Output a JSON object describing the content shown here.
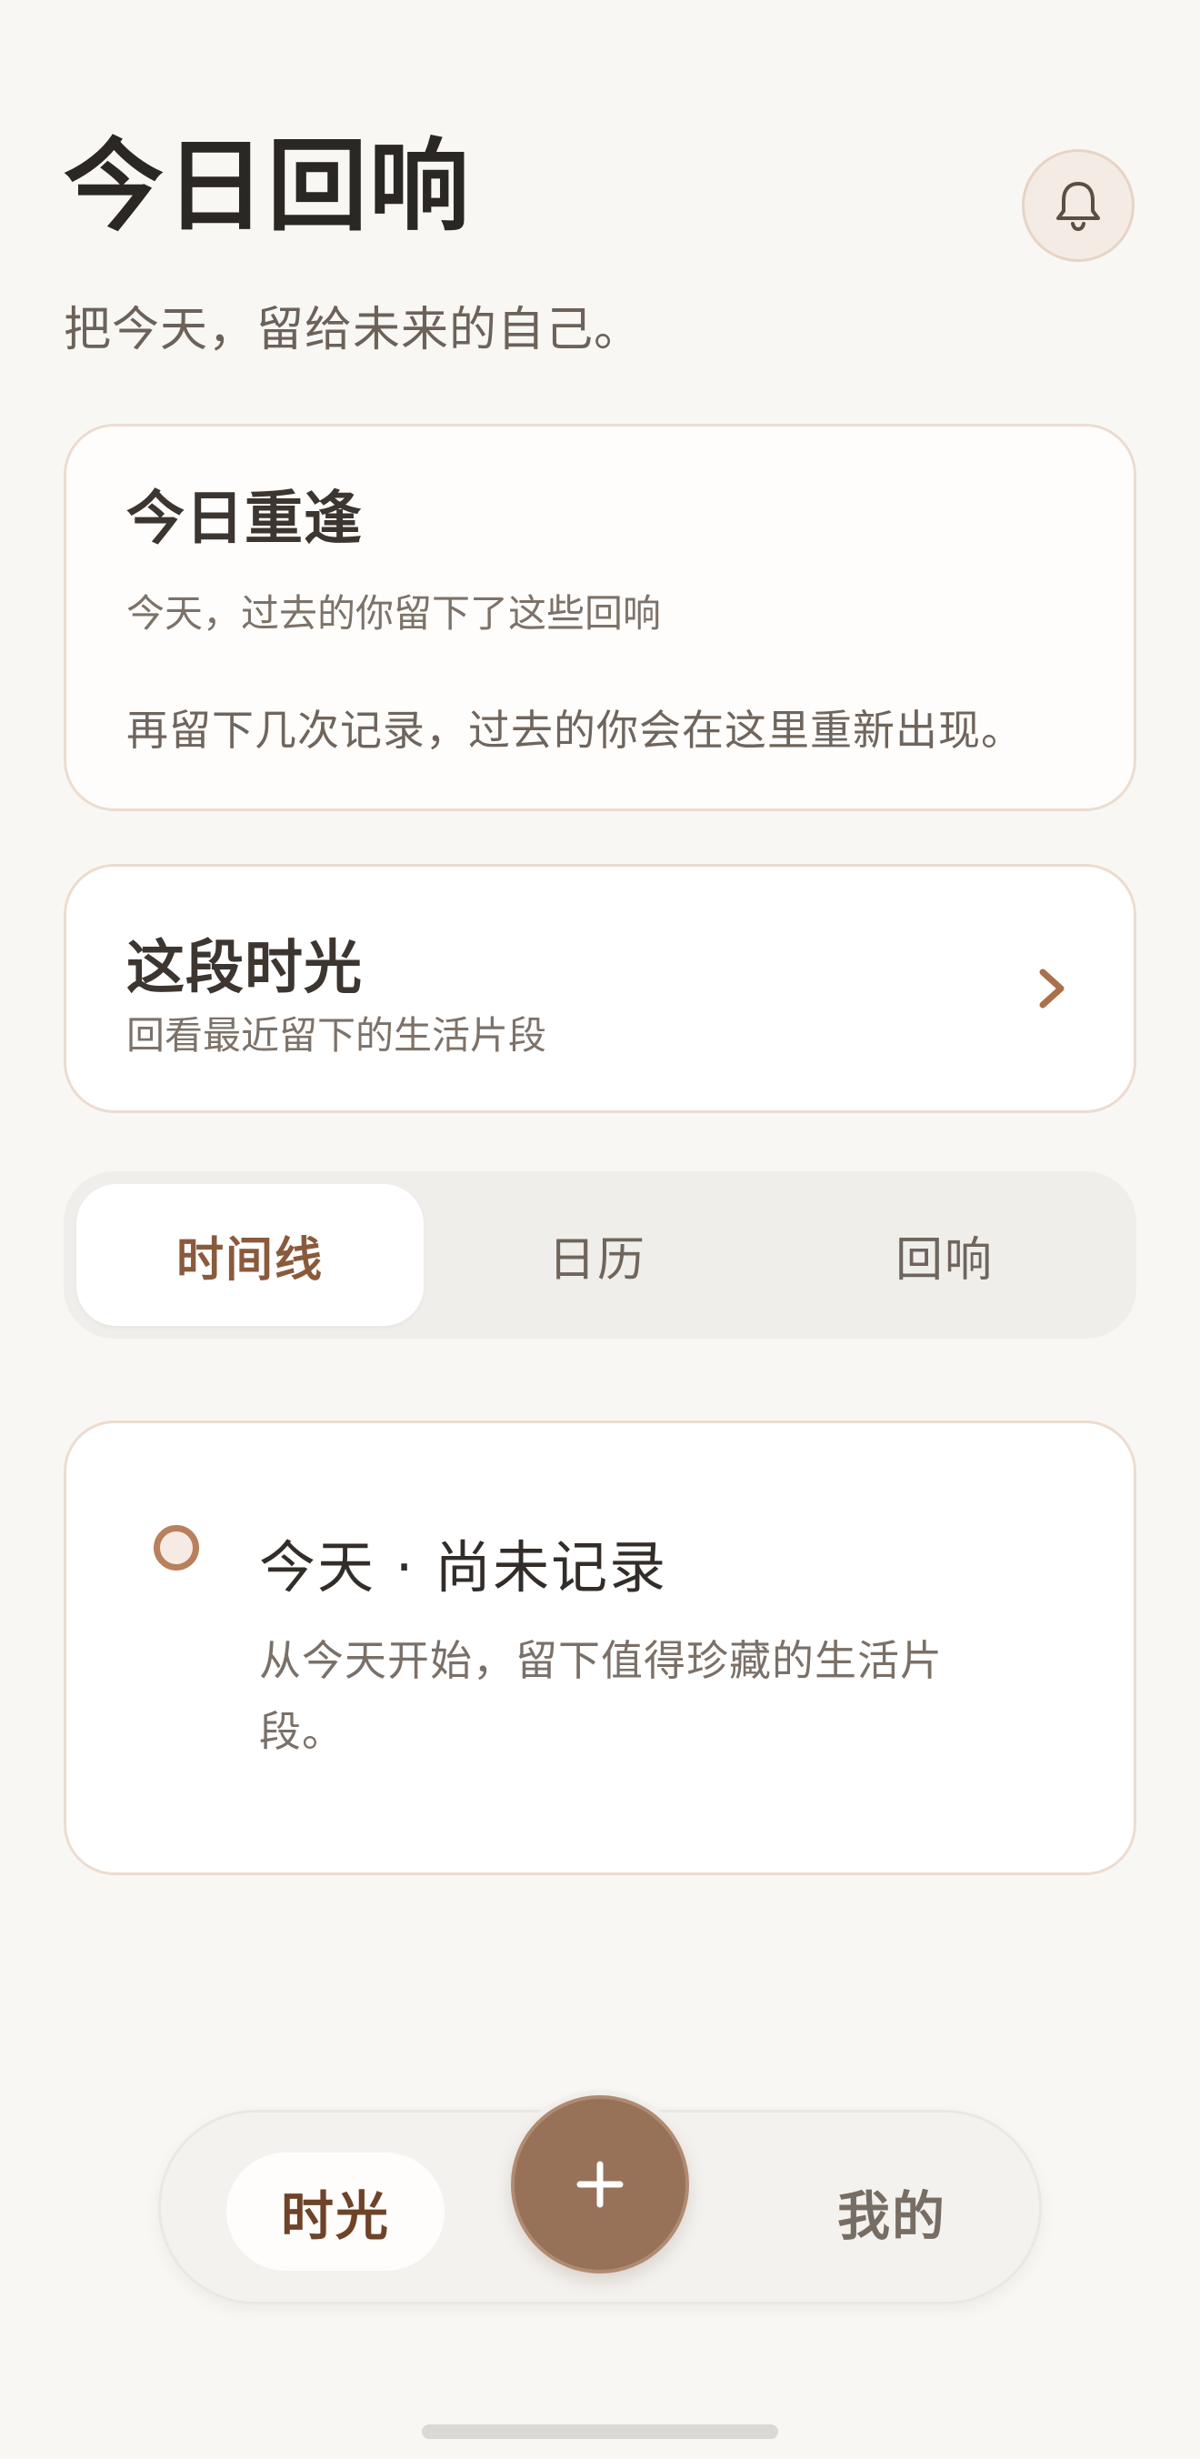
{
  "header": {
    "title": "今日回响",
    "subtitle": "把今天，留给未来的自己。",
    "bell_icon": "bell-icon"
  },
  "reunion_card": {
    "title": "今日重逢",
    "subtitle": "今天，过去的你留下了这些回响",
    "message": "再留下几次记录，过去的你会在这里重新出现。"
  },
  "period_card": {
    "title": "这段时光",
    "subtitle": "回看最近留下的生活片段",
    "chevron_icon": "chevron-right-icon"
  },
  "tabs": [
    {
      "label": "时间线",
      "active": true
    },
    {
      "label": "日历",
      "active": false
    },
    {
      "label": "回响",
      "active": false
    }
  ],
  "timeline": {
    "title": "今天 · 尚未记录",
    "body": "从今天开始，留下值得珍藏的生活片段。"
  },
  "bottom_nav": {
    "left_label": "时光",
    "right_label": "我的",
    "fab_icon": "plus-icon"
  },
  "colors": {
    "accent": "#977158",
    "accent_text": "#8a5a3d",
    "background": "#f9f7f4"
  }
}
